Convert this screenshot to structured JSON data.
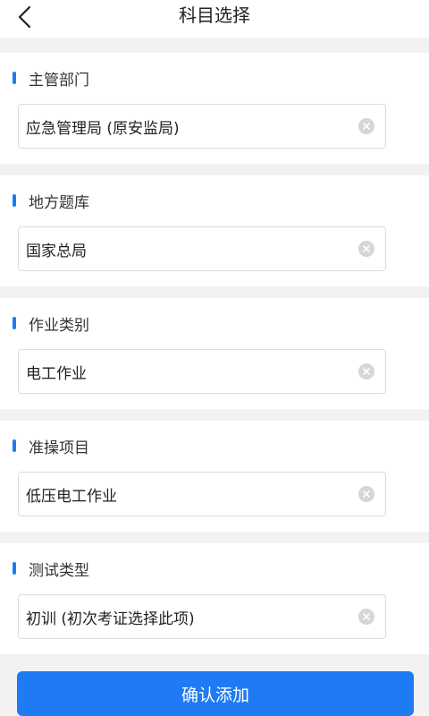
{
  "header": {
    "title": "科目选择",
    "back_icon": "chevron-left-icon"
  },
  "sections": [
    {
      "label": "主管部门",
      "value": "应急管理局 (原安监局)"
    },
    {
      "label": "地方题库",
      "value": "国家总局"
    },
    {
      "label": "作业类别",
      "value": "电工作业"
    },
    {
      "label": "准操项目",
      "value": "低压电工作业"
    },
    {
      "label": "测试类型",
      "value": "初训 (初次考证选择此项)"
    }
  ],
  "confirm_button": {
    "label": "确认添加"
  },
  "colors": {
    "accent": "#1e7bf3",
    "background": "#f2f2f2",
    "clear_icon": "#d6d6d6"
  }
}
